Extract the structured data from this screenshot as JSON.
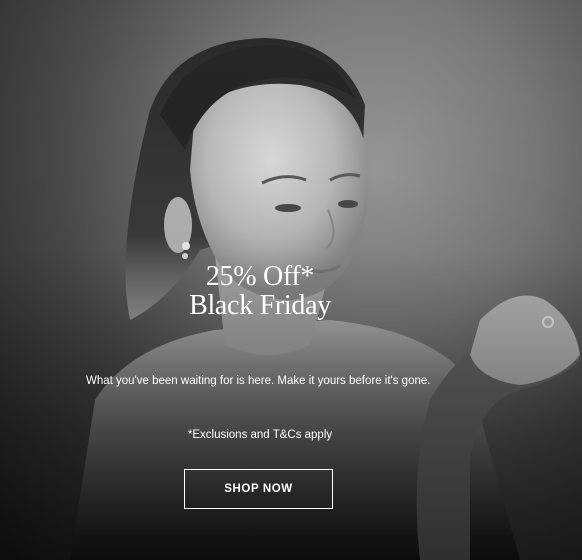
{
  "hero": {
    "headline_line1": "25% Off*",
    "headline_line2": "Black Friday",
    "subtext": "What you've been waiting for is here. Make it yours before it's gone.",
    "disclaimer": "*Exclusions and T&Cs apply",
    "cta_label": "SHOP NOW"
  },
  "colors": {
    "text": "#ffffff",
    "button_border": "#ffffff"
  }
}
